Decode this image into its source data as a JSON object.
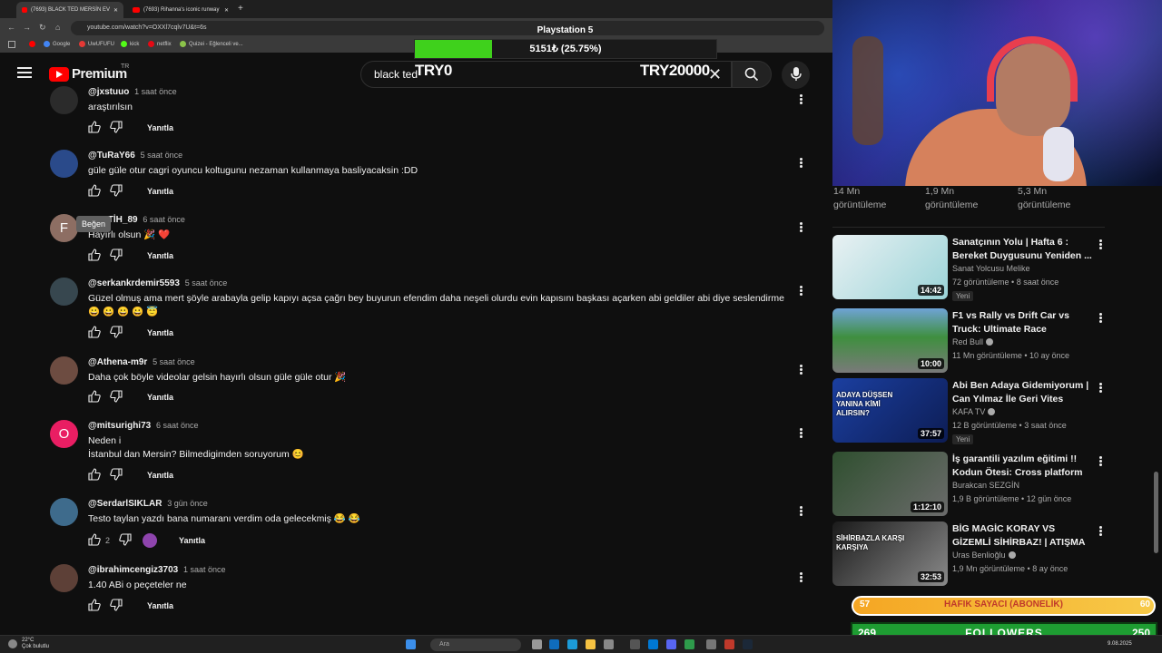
{
  "browser": {
    "tabs": [
      {
        "label": "(7693) BLACK TED MERSİN EV"
      },
      {
        "label": "(7693) Rihanna's iconic runway"
      }
    ],
    "url": "youtube.com/watch?v=OXXl7cqlv7U&t=6s",
    "bookmarks": [
      "Google",
      "UwUFUFU",
      "kick",
      "netflix",
      "Quizei - Eğlenceli ve..."
    ]
  },
  "youtube": {
    "logo_text": "Premium",
    "country_code": "TR",
    "search_value": "black ted"
  },
  "overlay": {
    "goal_title": "Playstation 5",
    "progress_text": "5151₺ (25.75%)",
    "progress_percent": 25.75,
    "start_label": "TRY0",
    "goal_label": "TRY20000"
  },
  "tooltip": "Beğen",
  "comments": [
    {
      "author": "@jxstuuo",
      "time": "1 saat önce",
      "lines": [
        "araştırılsın"
      ],
      "likes": "",
      "reply": "Yanıtla"
    },
    {
      "author": "@TuRaY66",
      "time": "5 saat önce",
      "lines": [
        "güle güle otur cagri oyuncu koltugunu nezaman kullanmaya basliyacaksin :DD"
      ],
      "likes": "",
      "reply": "Yanıtla"
    },
    {
      "author": "@FATİH_89",
      "time": "6 saat önce",
      "lines": [
        "Hayırlı olsun 🎉 ❤️"
      ],
      "likes": "",
      "reply": "Yanıtla",
      "avatar_letter": "F"
    },
    {
      "author": "@serkankrdemir5593",
      "time": "5 saat önce",
      "lines": [
        "Güzel olmuş ama mert şöyle arabayla gelip kapıyı açsa çağrı bey buyurun efendim daha neşeli olurdu  evin kapısını başkası açarken abi geldiler abi diye seslendirme",
        "😀 😀 😀 😀 😇"
      ],
      "likes": "",
      "reply": "Yanıtla"
    },
    {
      "author": "@Athena-m9r",
      "time": "5 saat önce",
      "lines": [
        "Daha çok böyle videolar gelsin hayırlı olsun güle güle otur 🎉"
      ],
      "likes": "",
      "reply": "Yanıtla"
    },
    {
      "author": "@mitsurighi73",
      "time": "6 saat önce",
      "lines": [
        "Neden i",
        "İstanbul dan Mersin?  Bilmedigimden soruyorum 😊"
      ],
      "likes": "",
      "reply": "Yanıtla",
      "avatar_letter": "O"
    },
    {
      "author": "@SerdarlSIKLAR",
      "time": "3 gün önce",
      "lines": [
        "Testo taylan yazdı bana numaranı verdim oda gelecekmiş 😂 😂"
      ],
      "likes": "2",
      "reply": "Yanıtla"
    },
    {
      "author": "@ibrahimcengiz3703",
      "time": "1 saat önce",
      "lines": [
        "1.40 ABi o peçeteler ne"
      ],
      "likes": "",
      "reply": "Yanıtla"
    }
  ],
  "view_stats": [
    {
      "count": "14 Mn",
      "label": "görüntüleme"
    },
    {
      "count": "1,9 Mn",
      "label": "görüntüleme"
    },
    {
      "count": "5,3 Mn",
      "label": "görüntüleme"
    }
  ],
  "videos": [
    {
      "title": "Sanatçının Yolu | Hafta 6 : Bereket Duygusunu Yeniden ...",
      "channel": "Sanat Yolcusu Melike",
      "meta": "72 görüntüleme • 8 saat önce",
      "duration": "14:42",
      "badge": "Yeni",
      "verified": false
    },
    {
      "title": "F1 vs Rally vs Drift Car vs Truck: Ultimate Race",
      "channel": "Red Bull",
      "meta": "11 Mn görüntüleme • 10 ay önce",
      "duration": "10:00",
      "badge": "",
      "verified": true
    },
    {
      "title": "Abi Ben Adaya Gidemiyorum | Can Yılmaz İle Geri Vites",
      "channel": "KAFA TV",
      "meta": "12 B görüntüleme • 3 saat önce",
      "duration": "37:57",
      "badge": "Yeni",
      "verified": true,
      "thumb_text": "ADAYA DÜŞSEN YANINA KİMİ ALIRSIN?"
    },
    {
      "title": "İş garantili yazılım eğitimi !! Kodun Ötesi: Cross platform ...",
      "channel": "Burakcan SEZGİN",
      "meta": "1,9 B görüntüleme • 12 gün önce",
      "duration": "1:12:10",
      "badge": "",
      "verified": false
    },
    {
      "title": "BİG MAGİC KORAY VS GİZEMLİ SİHİRBAZ! | ATIŞMA",
      "channel": "Uras Benlioğlu",
      "meta": "1,9 Mn görüntüleme • 8 ay önce",
      "duration": "32:53",
      "badge": "",
      "verified": true,
      "thumb_text": "SİHİRBAZLA KARŞI KARŞIYA"
    }
  ],
  "stream_widgets": {
    "sub_label": "HAFIK SAYACI (ABONELİK)",
    "sub_current": "57",
    "sub_goal": "60",
    "followers_label": "FOLLOWERS",
    "followers_current": "269",
    "followers_goal": "250"
  },
  "taskbar": {
    "weather_temp": "22°C",
    "weather_desc": "Çok bulutlu",
    "search_placeholder": "Ara",
    "date": "9.08.2025"
  },
  "colors": {
    "background": "#0f0f0f",
    "youtube_red": "#ff0000",
    "progress_green": "#3fd11c",
    "followers_green": "#1e9d32",
    "sub_gold": "#f5a623"
  }
}
